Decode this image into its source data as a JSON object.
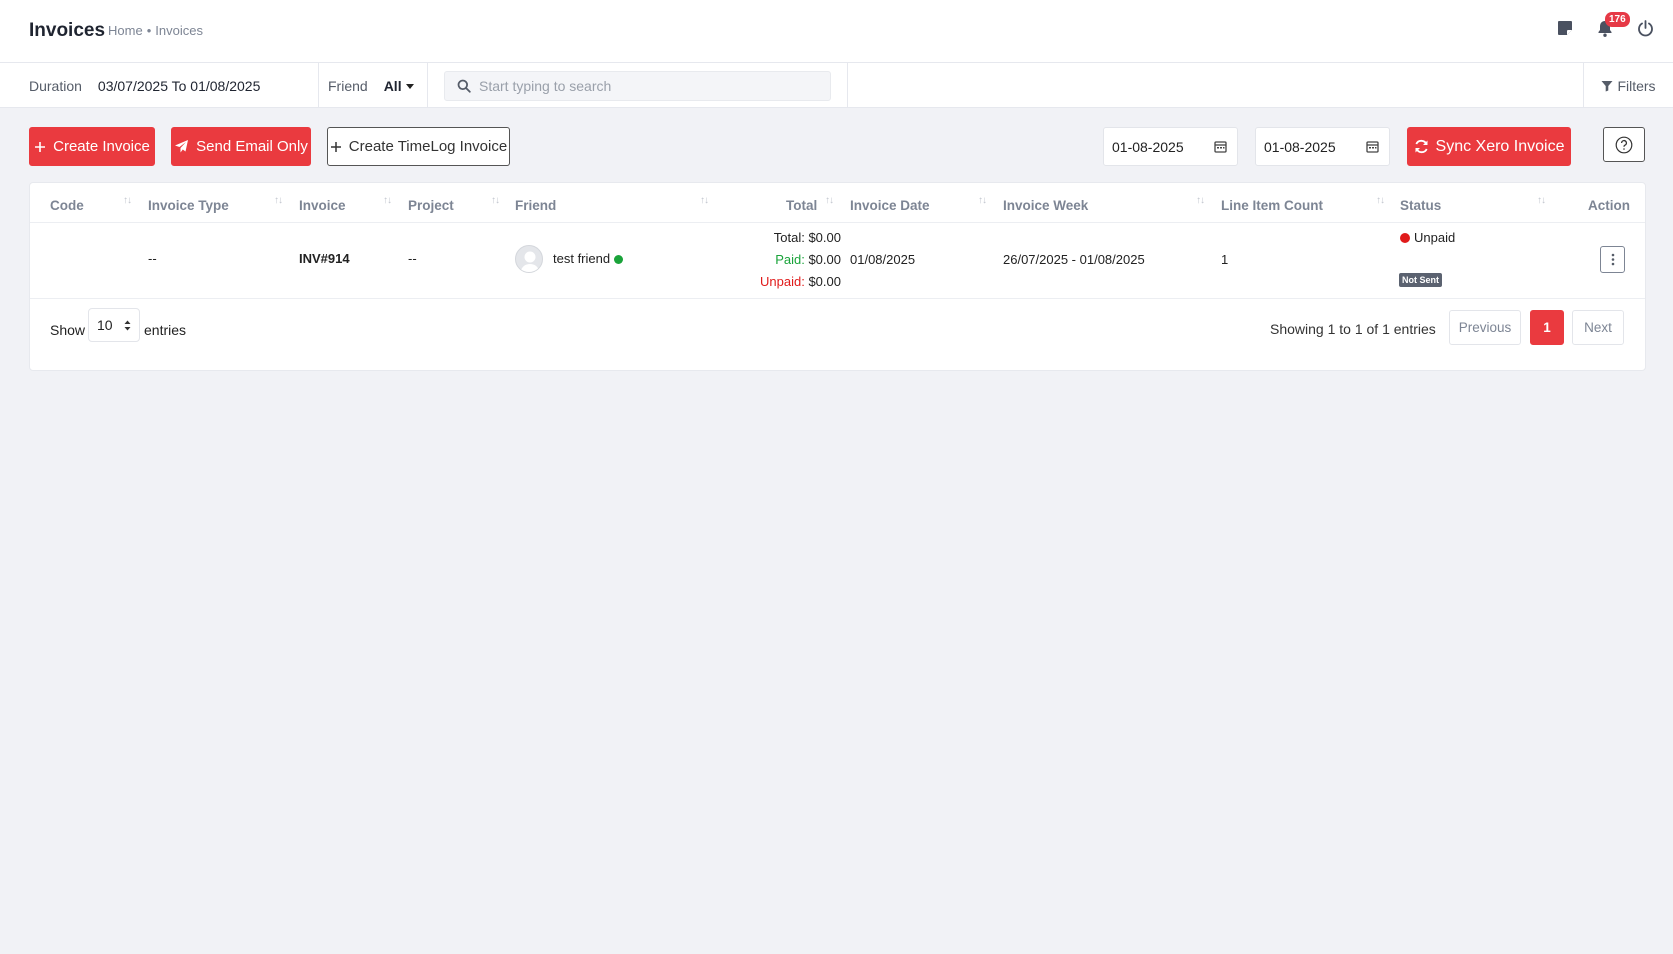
{
  "header": {
    "title": "Invoices",
    "breadcrumb": {
      "home": "Home",
      "separator": "•",
      "current": "Invoices"
    },
    "notification_count": "176"
  },
  "filter_bar": {
    "duration_label": "Duration",
    "duration_value": "03/07/2025 To 01/08/2025",
    "friend_label": "Friend",
    "friend_value": "All",
    "search_placeholder": "Start typing to search",
    "search_value": "",
    "filters_label": "Filters"
  },
  "toolbar": {
    "create_invoice": "Create Invoice",
    "send_email_only": "Send Email Only",
    "create_timelog_invoice": "Create TimeLog Invoice",
    "date_from": "01-08-2025",
    "date_to": "01-08-2025",
    "sync_xero": "Sync Xero Invoice",
    "help_icon": "question-circle-icon"
  },
  "table": {
    "columns": [
      "Code",
      "Invoice Type",
      "Invoice",
      "Project",
      "Friend",
      "Total",
      "Invoice Date",
      "Invoice Week",
      "Line Item Count",
      "Status",
      "Action"
    ],
    "rows": [
      {
        "code": "",
        "invoice_type": "--",
        "invoice": "INV#914",
        "project": "--",
        "friend": "test friend",
        "total_label": "Total:",
        "total_value": "$0.00",
        "paid_label": "Paid:",
        "paid_value": "$0.00",
        "unpaid_label": "Unpaid:",
        "unpaid_value": "$0.00",
        "invoice_date": "01/08/2025",
        "invoice_week": "26/07/2025 - 01/08/2025",
        "line_item_count": "1",
        "status": "Unpaid",
        "sent_badge": "Not Sent"
      }
    ]
  },
  "pagination": {
    "show_label": "Show",
    "page_size": "10",
    "entries_label": "entries",
    "summary": "Showing 1 to 1 of 1 entries",
    "previous": "Previous",
    "current_page": "1",
    "next": "Next"
  },
  "colors": {
    "accent": "#ea3a3f",
    "paid": "#1aa33a",
    "unpaid": "#e01b1b",
    "online": "#1aa33a"
  }
}
